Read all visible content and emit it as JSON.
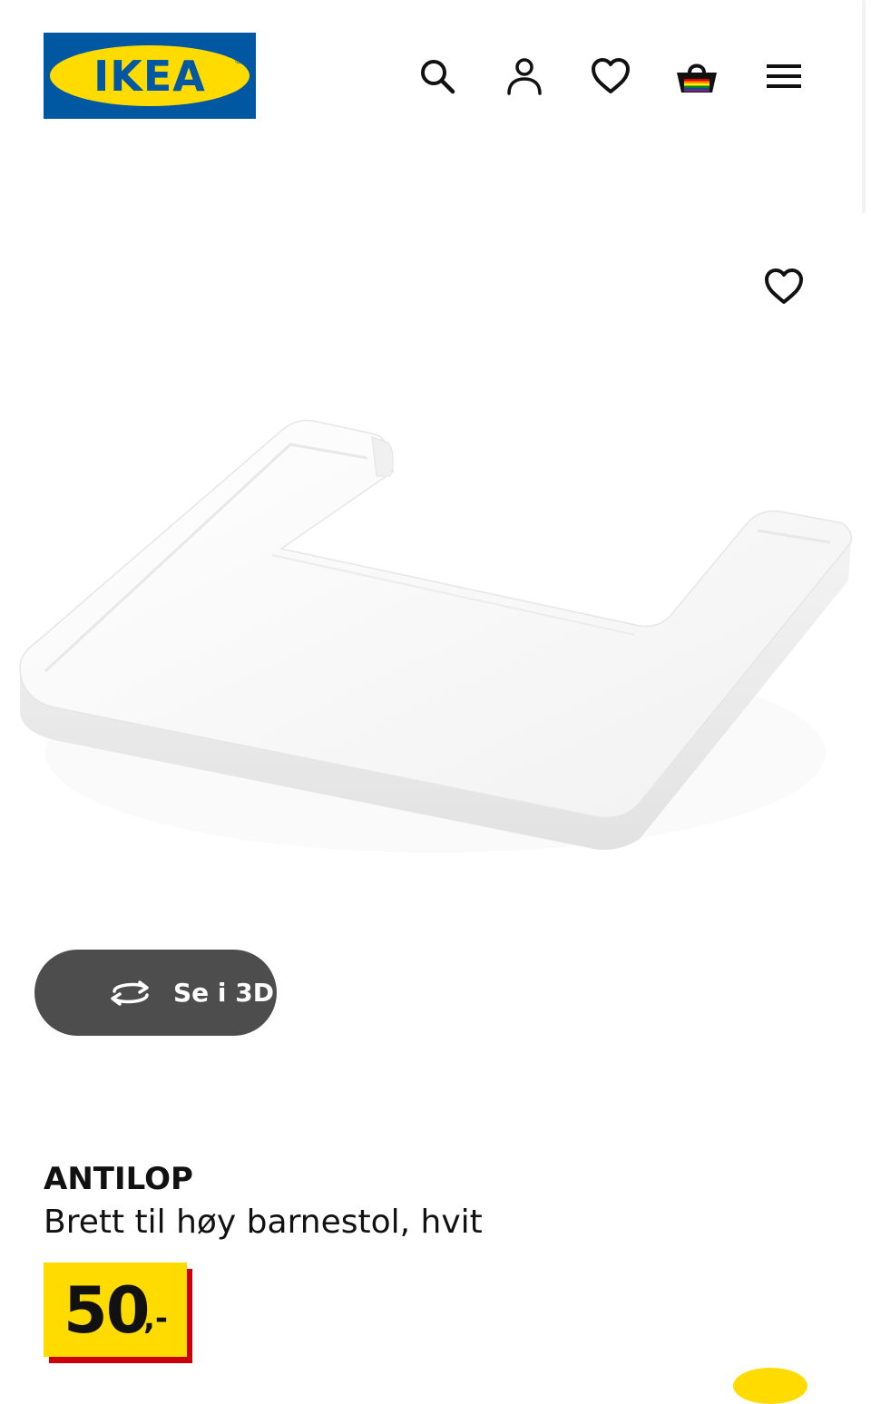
{
  "header": {
    "logo_text": "IKEA",
    "logo_reg": "®",
    "icons": [
      "search-icon",
      "account-icon",
      "heart-icon",
      "basket-icon",
      "menu-icon"
    ]
  },
  "colors": {
    "ikea_blue": "#0058a3",
    "ikea_yellow": "#ffdb00",
    "price_red": "#cc0008",
    "button_gray": "#4d4d4d"
  },
  "product": {
    "name": "ANTILOP",
    "description": "Brett til høy barnestol, hvit",
    "price_integer": "50",
    "price_suffix": ",-",
    "view_3d_label": "Se i 3D"
  }
}
